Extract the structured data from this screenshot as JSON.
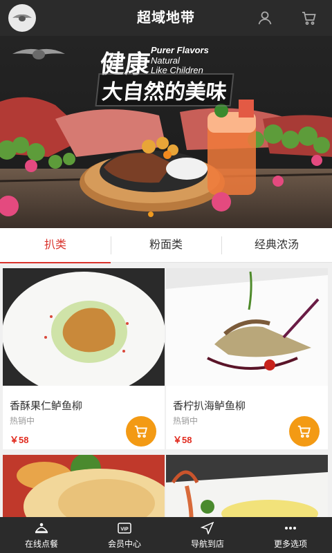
{
  "header": {
    "title": "超域地带",
    "logo_icon": "car-logo-icon",
    "user_icon": "user-icon",
    "cart_icon": "cart-icon"
  },
  "banner": {
    "headline_line1": "健康",
    "headline_line2": "大自然的美味",
    "english_line1": "Purer Flavors",
    "english_line2": "Natural",
    "english_line3": "Like Children",
    "accent_color": "#f09a1f"
  },
  "tabs": [
    {
      "label": "扒类",
      "active": true
    },
    {
      "label": "粉面类",
      "active": false
    },
    {
      "label": "经典浓汤",
      "active": false
    }
  ],
  "products": [
    {
      "name": "香酥果仁鲈鱼柳",
      "status": "热销中",
      "price": "￥58"
    },
    {
      "name": "香柠扒海鲈鱼柳",
      "status": "热销中",
      "price": "￥58"
    },
    {
      "name": "",
      "status": "",
      "price": ""
    },
    {
      "name": "",
      "status": "",
      "price": ""
    }
  ],
  "bottom_nav": [
    {
      "label": "在线点餐",
      "icon": "chef-hat-icon"
    },
    {
      "label": "会员中心",
      "icon": "vip-card-icon"
    },
    {
      "label": "导航到店",
      "icon": "navigation-arrow-icon"
    },
    {
      "label": "更多选项",
      "icon": "more-dots-icon"
    }
  ],
  "colors": {
    "header_bg": "#2b2b2b",
    "active_tab": "#d9322b",
    "price": "#e12b1f",
    "cart_button": "#f39a14"
  }
}
